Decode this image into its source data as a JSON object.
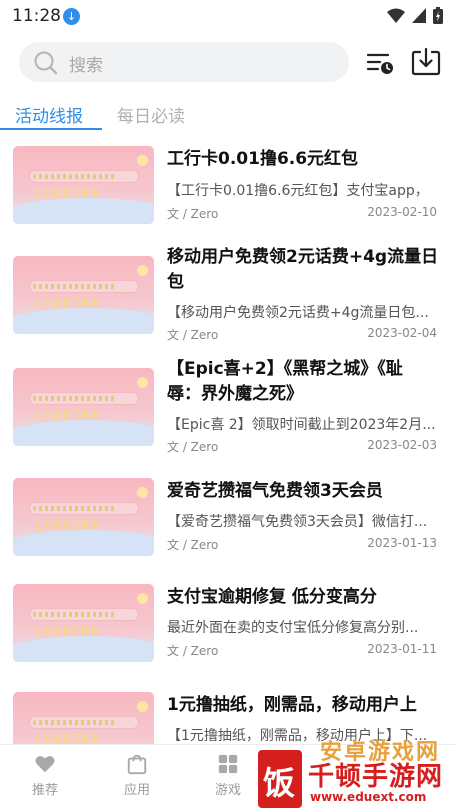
{
  "status": {
    "time": "11:28"
  },
  "search": {
    "placeholder": "搜索"
  },
  "tabs": [
    {
      "label": "活动线报",
      "active": true
    },
    {
      "label": "每日必读",
      "active": false
    }
  ],
  "items": [
    {
      "thumb_text": "LOADING",
      "title_line1": "工行卡0.01撸6.6元红包",
      "title_line2": "",
      "excerpt": "【工行卡0.01撸6.6元红包】支付宝app，",
      "author": "文 / Zero",
      "date": "2023-02-10"
    },
    {
      "thumb_text": "LOADING",
      "title_line1": "移动用户免费领2元话费+4g流量日",
      "title_line2": "包",
      "excerpt": "【移动用户免费领2元话费+4g流量日包...",
      "author": "文 / Zero",
      "date": "2023-02-04"
    },
    {
      "thumb_text": "LOADING",
      "title_line1": "【Epic喜+2】《黑帮之城》《耻",
      "title_line2": "辱：界外魔之死》",
      "excerpt": "【Epic喜 2】领取时间截止到2023年2月...",
      "author": "文 / Zero",
      "date": "2023-02-03"
    },
    {
      "thumb_text": "LOADING",
      "title_line1": "爱奇艺攒福气免费领3天会员",
      "title_line2": "",
      "excerpt": "【爱奇艺攒福气免费领3天会员】微信打...",
      "author": "文 / Zero",
      "date": "2023-01-13"
    },
    {
      "thumb_text": "LOADING",
      "title_line1": "支付宝逾期修复 低分变高分",
      "title_line2": "",
      "excerpt": "最近外面在卖的支付宝低分修复高分别...",
      "author": "文 / Zero",
      "date": "2023-01-11"
    },
    {
      "thumb_text": "LOADING",
      "title_line1": "1元撸抽纸，刚需品，移动用户上",
      "title_line2": "",
      "excerpt": "【1元撸抽纸，刚需品，移动用户上】下...",
      "author": "",
      "date": ""
    }
  ],
  "bottom_nav": [
    {
      "label": "推荐",
      "icon": "heart-icon"
    },
    {
      "label": "应用",
      "icon": "bag-icon"
    },
    {
      "label": "游戏",
      "icon": "grid-icon"
    }
  ],
  "watermark": {
    "top": "安卓游戏网",
    "main": "千顿手游网",
    "url": "www.eduext.com",
    "box": "饭"
  },
  "colors": {
    "accent": "#2f8fe8",
    "watermark_red": "#d51f1f"
  }
}
